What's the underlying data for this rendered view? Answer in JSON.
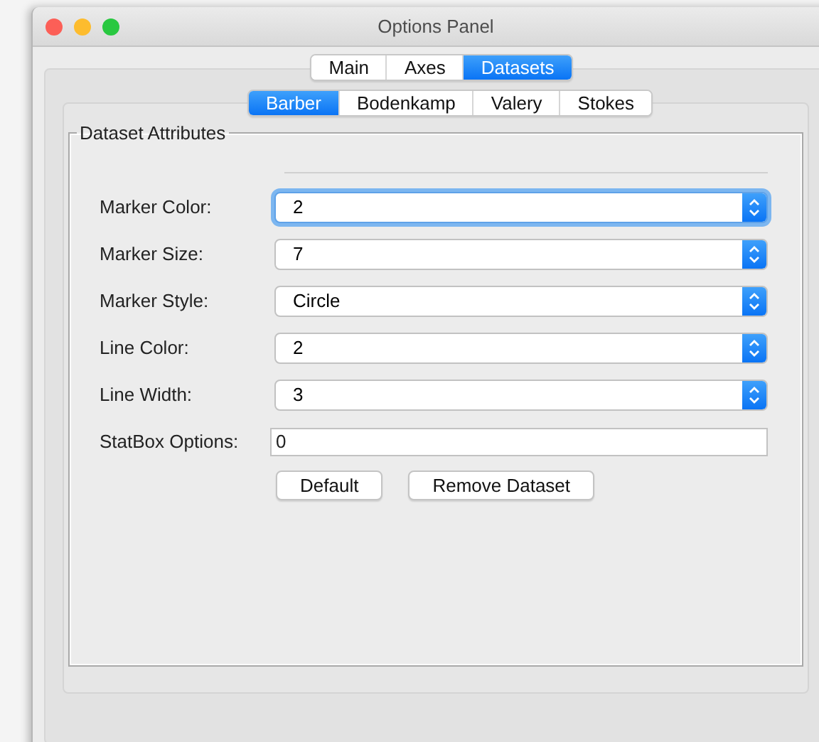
{
  "window": {
    "title": "Options Panel"
  },
  "tabs": [
    {
      "label": "Main",
      "selected": false
    },
    {
      "label": "Axes",
      "selected": false
    },
    {
      "label": "Datasets",
      "selected": true
    }
  ],
  "dataset_tabs": [
    {
      "label": "Barber",
      "selected": true
    },
    {
      "label": "Bodenkamp",
      "selected": false
    },
    {
      "label": "Valery",
      "selected": false
    },
    {
      "label": "Stokes",
      "selected": false
    }
  ],
  "group": {
    "title": "Dataset Attributes"
  },
  "fields": [
    {
      "label": "Marker Color:",
      "value": "2",
      "kind": "select",
      "focused": true
    },
    {
      "label": "Marker Size:",
      "value": "7",
      "kind": "select",
      "focused": false
    },
    {
      "label": "Marker Style:",
      "value": "Circle",
      "kind": "select",
      "focused": false
    },
    {
      "label": "Line Color:",
      "value": "2",
      "kind": "select",
      "focused": false
    },
    {
      "label": "Line Width:",
      "value": "3",
      "kind": "select",
      "focused": false
    },
    {
      "label": "StatBox Options:",
      "value": "0",
      "kind": "text",
      "focused": false
    }
  ],
  "buttons": [
    "Default",
    "Remove Dataset"
  ]
}
